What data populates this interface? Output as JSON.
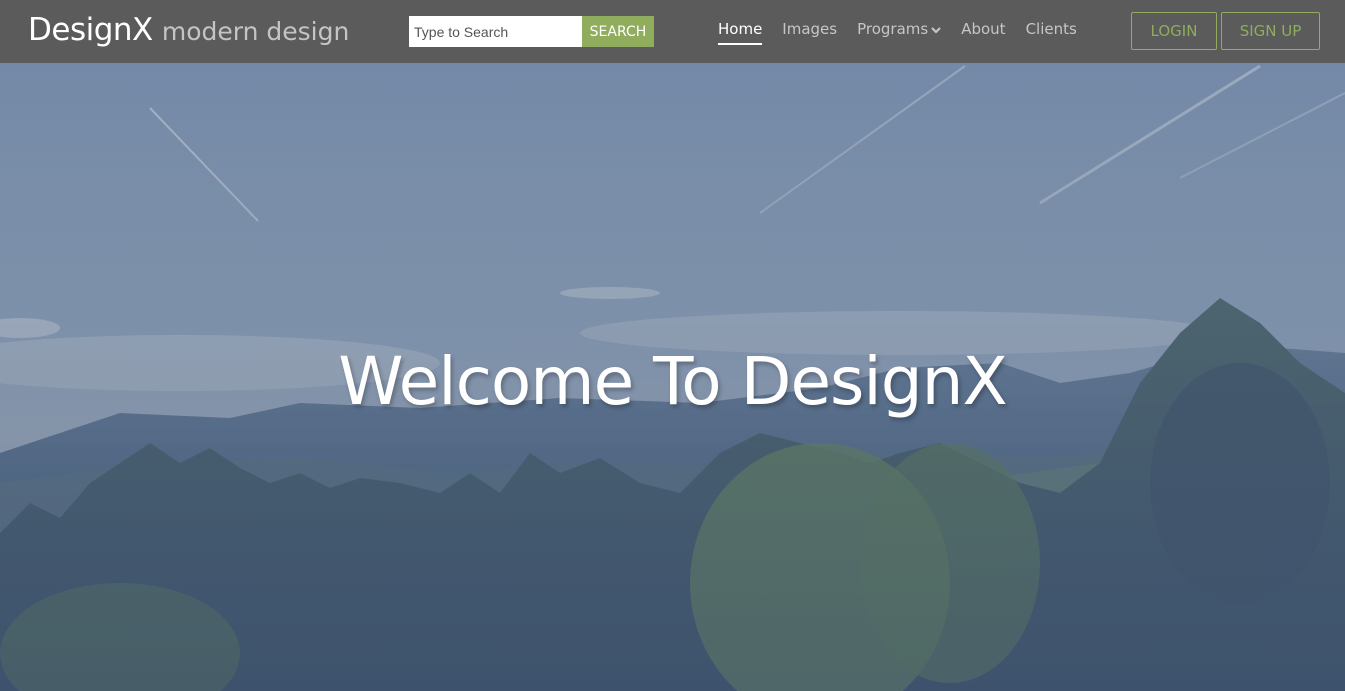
{
  "brand": {
    "name": "DesignX",
    "tagline": "modern design"
  },
  "search": {
    "placeholder": "Type to Search",
    "button_label": "SEARCH"
  },
  "nav": {
    "items": [
      {
        "label": "Home",
        "active": true
      },
      {
        "label": "Images"
      },
      {
        "label": "Programs",
        "has_dropdown": true,
        "icon": "chevron-down-icon"
      },
      {
        "label": "About"
      },
      {
        "label": "Clients"
      }
    ]
  },
  "auth": {
    "login_label": "LOGIN",
    "signup_label": "SIGN UP"
  },
  "hero": {
    "title": "Welcome To DesignX"
  },
  "colors": {
    "topbar": "#5b5b5b",
    "accent": "#8fad5c",
    "overlay": "#4a5a70"
  }
}
